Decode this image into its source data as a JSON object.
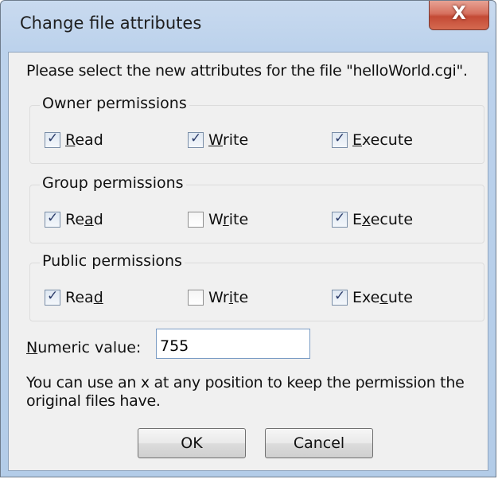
{
  "window": {
    "title": "Change file attributes",
    "close_glyph": "X"
  },
  "intro_text": "Please select the new attributes for the file \"helloWorld.cgi\".",
  "groups": [
    {
      "title": "Owner permissions",
      "read": {
        "pre": "",
        "key": "R",
        "post": "ead",
        "checked": true
      },
      "write": {
        "pre": "",
        "key": "W",
        "post": "rite",
        "checked": true
      },
      "execute": {
        "pre": "",
        "key": "E",
        "post": "xecute",
        "checked": true
      }
    },
    {
      "title": "Group permissions",
      "read": {
        "pre": "Re",
        "key": "a",
        "post": "d",
        "checked": true
      },
      "write": {
        "pre": "W",
        "key": "r",
        "post": "ite",
        "checked": false
      },
      "execute": {
        "pre": "E",
        "key": "x",
        "post": "ecute",
        "checked": true
      }
    },
    {
      "title": "Public permissions",
      "read": {
        "pre": "Rea",
        "key": "d",
        "post": "",
        "checked": true
      },
      "write": {
        "pre": "Wr",
        "key": "i",
        "post": "te",
        "checked": false
      },
      "execute": {
        "pre": "Exe",
        "key": "c",
        "post": "ute",
        "checked": true
      }
    }
  ],
  "numeric": {
    "label_key": "N",
    "label_rest": "umeric value:",
    "value": "755"
  },
  "hint": "You can use an x at any position to keep the permission the original files have.",
  "buttons": {
    "ok": "OK",
    "cancel": "Cancel"
  }
}
